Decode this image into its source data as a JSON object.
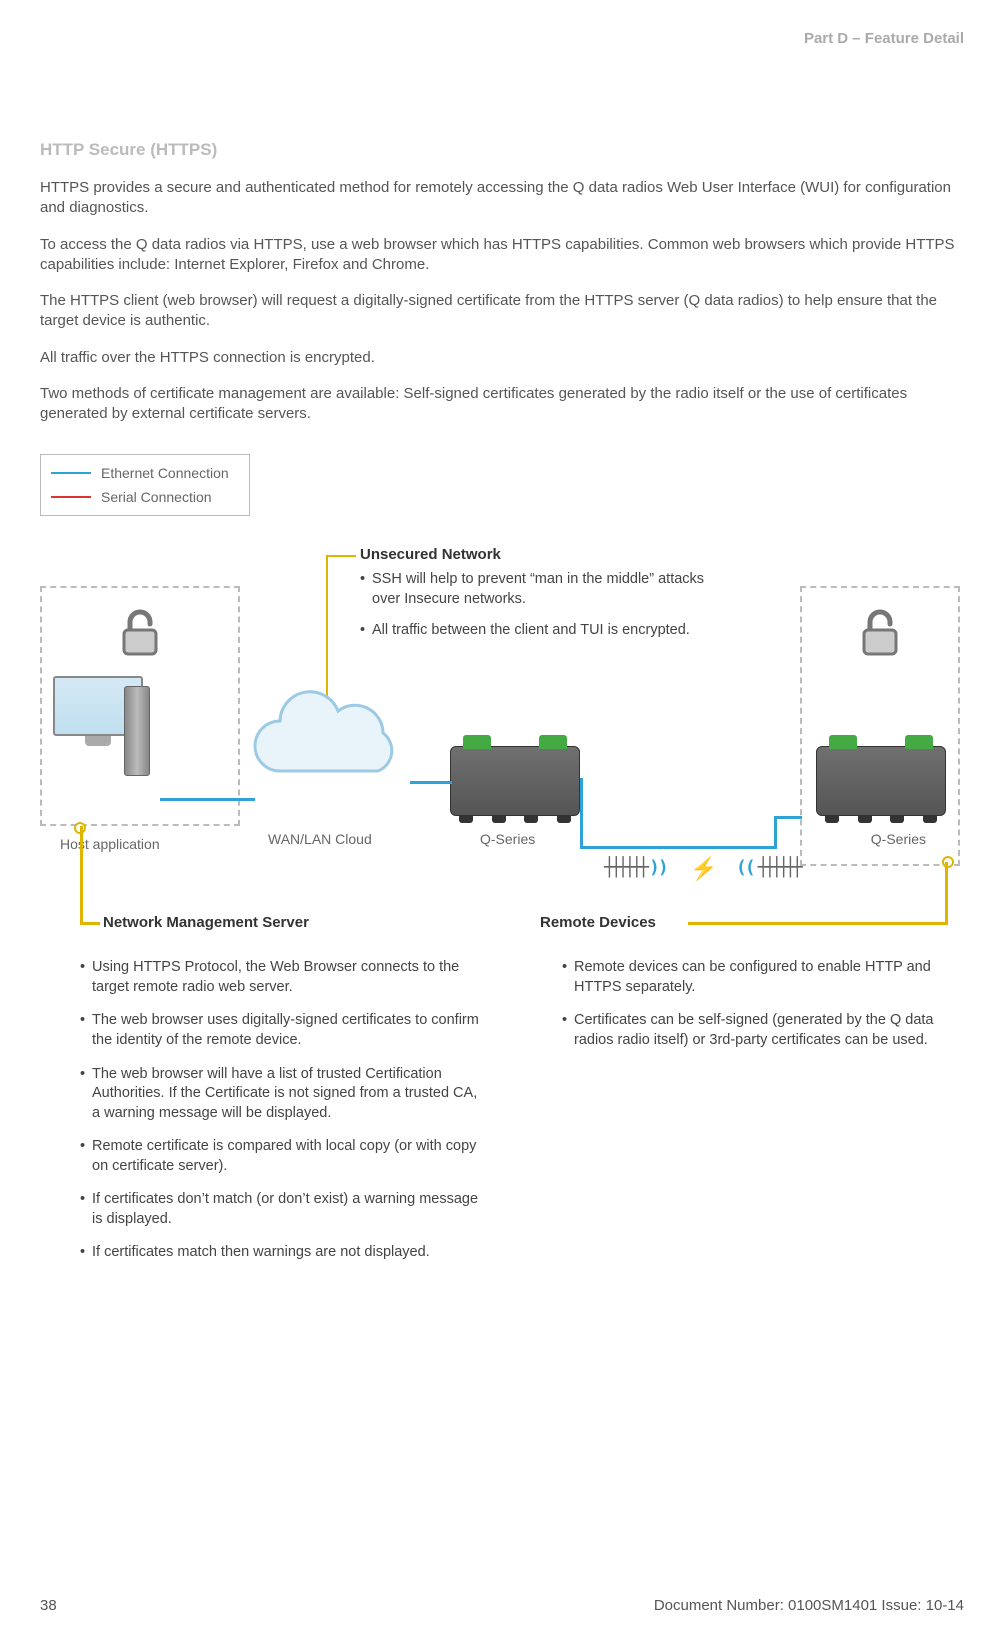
{
  "header": {
    "part_label": "Part D – Feature Detail"
  },
  "section_title": "HTTP Secure (HTTPS)",
  "paragraphs": [
    "HTTPS provides a secure and authenticated method for remotely accessing the Q data radios Web User Interface (WUI) for configuration and diagnostics.",
    "To access the Q data radios via HTTPS, use a web browser which has HTTPS capabilities. Common web browsers which provide HTTPS capabilities include: Internet Explorer, Firefox and Chrome.",
    "The HTTPS client (web browser) will request a digitally-signed certificate from the HTTPS server (Q data radios) to help ensure that the target device is authentic.",
    "All traffic over the HTTPS connection is encrypted.",
    "Two methods of certificate management are available: Self-signed certificates generated by the radio itself or the use of certificates generated by external certificate servers."
  ],
  "legend": {
    "ethernet": "Ethernet Connection",
    "serial": "Serial Connection"
  },
  "diagram": {
    "host_label": "Host application",
    "cloud_label": "WAN/LAN Cloud",
    "qseries_label": "Q-Series"
  },
  "callouts": {
    "unsecured": {
      "title": "Unsecured Network",
      "items": [
        "SSH will help to prevent “man in the middle” attacks over Insecure networks.",
        "All traffic between the client and TUI is encrypted."
      ]
    },
    "nms": {
      "title": "Network Management Server",
      "items": [
        "Using HTTPS Protocol, the Web Browser connects to the target remote radio web server.",
        "The web browser uses digitally-signed certificates to confirm the identity of the remote device.",
        "The web browser will have a list of trusted Certification Authorities. If the Certificate is not signed from a trusted CA, a warning message will be displayed.",
        "Remote certificate is compared with local copy (or with copy on certificate server).",
        "If certificates don’t match (or don’t exist) a warning message is displayed.",
        "If certificates match then warnings are not displayed."
      ]
    },
    "remote": {
      "title": "Remote Devices",
      "items": [
        "Remote devices can be configured to enable HTTP and HTTPS separately.",
        "Certificates can be self-signed (generated by the  Q data radios radio itself) or 3rd-party certificates can be used."
      ]
    }
  },
  "footer": {
    "page": "38",
    "doc": "Document Number: 0100SM1401   Issue: 10-14"
  }
}
